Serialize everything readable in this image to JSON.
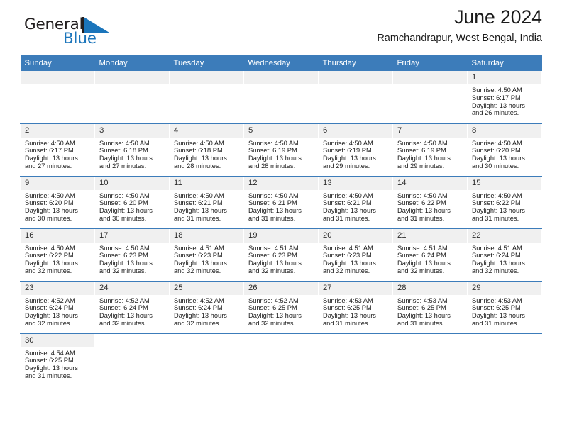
{
  "brand": {
    "name_top": "General",
    "name_bottom": "Blue",
    "accent_color": "#1b75bb"
  },
  "header": {
    "title": "June 2024",
    "subtitle": "Ramchandrapur, West Bengal, India"
  },
  "theme": {
    "header_bg": "#3c7cba",
    "daynum_bg": "#f0f0f0",
    "grid_line": "#3c7cba",
    "text": "#1a1a1a"
  },
  "weekday_headers": [
    "Sunday",
    "Monday",
    "Tuesday",
    "Wednesday",
    "Thursday",
    "Friday",
    "Saturday"
  ],
  "labels": {
    "sunrise": "Sunrise:",
    "sunset": "Sunset:",
    "daylight": "Daylight:"
  },
  "weeks": [
    [
      {
        "empty": true
      },
      {
        "empty": true
      },
      {
        "empty": true
      },
      {
        "empty": true
      },
      {
        "empty": true
      },
      {
        "empty": true
      },
      {
        "day": "1",
        "sunrise": "Sunrise: 4:50 AM",
        "sunset": "Sunset: 6:17 PM",
        "daylight1": "Daylight: 13 hours",
        "daylight2": "and 26 minutes."
      }
    ],
    [
      {
        "day": "2",
        "sunrise": "Sunrise: 4:50 AM",
        "sunset": "Sunset: 6:17 PM",
        "daylight1": "Daylight: 13 hours",
        "daylight2": "and 27 minutes."
      },
      {
        "day": "3",
        "sunrise": "Sunrise: 4:50 AM",
        "sunset": "Sunset: 6:18 PM",
        "daylight1": "Daylight: 13 hours",
        "daylight2": "and 27 minutes."
      },
      {
        "day": "4",
        "sunrise": "Sunrise: 4:50 AM",
        "sunset": "Sunset: 6:18 PM",
        "daylight1": "Daylight: 13 hours",
        "daylight2": "and 28 minutes."
      },
      {
        "day": "5",
        "sunrise": "Sunrise: 4:50 AM",
        "sunset": "Sunset: 6:19 PM",
        "daylight1": "Daylight: 13 hours",
        "daylight2": "and 28 minutes."
      },
      {
        "day": "6",
        "sunrise": "Sunrise: 4:50 AM",
        "sunset": "Sunset: 6:19 PM",
        "daylight1": "Daylight: 13 hours",
        "daylight2": "and 29 minutes."
      },
      {
        "day": "7",
        "sunrise": "Sunrise: 4:50 AM",
        "sunset": "Sunset: 6:19 PM",
        "daylight1": "Daylight: 13 hours",
        "daylight2": "and 29 minutes."
      },
      {
        "day": "8",
        "sunrise": "Sunrise: 4:50 AM",
        "sunset": "Sunset: 6:20 PM",
        "daylight1": "Daylight: 13 hours",
        "daylight2": "and 30 minutes."
      }
    ],
    [
      {
        "day": "9",
        "sunrise": "Sunrise: 4:50 AM",
        "sunset": "Sunset: 6:20 PM",
        "daylight1": "Daylight: 13 hours",
        "daylight2": "and 30 minutes."
      },
      {
        "day": "10",
        "sunrise": "Sunrise: 4:50 AM",
        "sunset": "Sunset: 6:20 PM",
        "daylight1": "Daylight: 13 hours",
        "daylight2": "and 30 minutes."
      },
      {
        "day": "11",
        "sunrise": "Sunrise: 4:50 AM",
        "sunset": "Sunset: 6:21 PM",
        "daylight1": "Daylight: 13 hours",
        "daylight2": "and 31 minutes."
      },
      {
        "day": "12",
        "sunrise": "Sunrise: 4:50 AM",
        "sunset": "Sunset: 6:21 PM",
        "daylight1": "Daylight: 13 hours",
        "daylight2": "and 31 minutes."
      },
      {
        "day": "13",
        "sunrise": "Sunrise: 4:50 AM",
        "sunset": "Sunset: 6:21 PM",
        "daylight1": "Daylight: 13 hours",
        "daylight2": "and 31 minutes."
      },
      {
        "day": "14",
        "sunrise": "Sunrise: 4:50 AM",
        "sunset": "Sunset: 6:22 PM",
        "daylight1": "Daylight: 13 hours",
        "daylight2": "and 31 minutes."
      },
      {
        "day": "15",
        "sunrise": "Sunrise: 4:50 AM",
        "sunset": "Sunset: 6:22 PM",
        "daylight1": "Daylight: 13 hours",
        "daylight2": "and 31 minutes."
      }
    ],
    [
      {
        "day": "16",
        "sunrise": "Sunrise: 4:50 AM",
        "sunset": "Sunset: 6:22 PM",
        "daylight1": "Daylight: 13 hours",
        "daylight2": "and 32 minutes."
      },
      {
        "day": "17",
        "sunrise": "Sunrise: 4:50 AM",
        "sunset": "Sunset: 6:23 PM",
        "daylight1": "Daylight: 13 hours",
        "daylight2": "and 32 minutes."
      },
      {
        "day": "18",
        "sunrise": "Sunrise: 4:51 AM",
        "sunset": "Sunset: 6:23 PM",
        "daylight1": "Daylight: 13 hours",
        "daylight2": "and 32 minutes."
      },
      {
        "day": "19",
        "sunrise": "Sunrise: 4:51 AM",
        "sunset": "Sunset: 6:23 PM",
        "daylight1": "Daylight: 13 hours",
        "daylight2": "and 32 minutes."
      },
      {
        "day": "20",
        "sunrise": "Sunrise: 4:51 AM",
        "sunset": "Sunset: 6:23 PM",
        "daylight1": "Daylight: 13 hours",
        "daylight2": "and 32 minutes."
      },
      {
        "day": "21",
        "sunrise": "Sunrise: 4:51 AM",
        "sunset": "Sunset: 6:24 PM",
        "daylight1": "Daylight: 13 hours",
        "daylight2": "and 32 minutes."
      },
      {
        "day": "22",
        "sunrise": "Sunrise: 4:51 AM",
        "sunset": "Sunset: 6:24 PM",
        "daylight1": "Daylight: 13 hours",
        "daylight2": "and 32 minutes."
      }
    ],
    [
      {
        "day": "23",
        "sunrise": "Sunrise: 4:52 AM",
        "sunset": "Sunset: 6:24 PM",
        "daylight1": "Daylight: 13 hours",
        "daylight2": "and 32 minutes."
      },
      {
        "day": "24",
        "sunrise": "Sunrise: 4:52 AM",
        "sunset": "Sunset: 6:24 PM",
        "daylight1": "Daylight: 13 hours",
        "daylight2": "and 32 minutes."
      },
      {
        "day": "25",
        "sunrise": "Sunrise: 4:52 AM",
        "sunset": "Sunset: 6:24 PM",
        "daylight1": "Daylight: 13 hours",
        "daylight2": "and 32 minutes."
      },
      {
        "day": "26",
        "sunrise": "Sunrise: 4:52 AM",
        "sunset": "Sunset: 6:25 PM",
        "daylight1": "Daylight: 13 hours",
        "daylight2": "and 32 minutes."
      },
      {
        "day": "27",
        "sunrise": "Sunrise: 4:53 AM",
        "sunset": "Sunset: 6:25 PM",
        "daylight1": "Daylight: 13 hours",
        "daylight2": "and 31 minutes."
      },
      {
        "day": "28",
        "sunrise": "Sunrise: 4:53 AM",
        "sunset": "Sunset: 6:25 PM",
        "daylight1": "Daylight: 13 hours",
        "daylight2": "and 31 minutes."
      },
      {
        "day": "29",
        "sunrise": "Sunrise: 4:53 AM",
        "sunset": "Sunset: 6:25 PM",
        "daylight1": "Daylight: 13 hours",
        "daylight2": "and 31 minutes."
      }
    ],
    [
      {
        "day": "30",
        "sunrise": "Sunrise: 4:54 AM",
        "sunset": "Sunset: 6:25 PM",
        "daylight1": "Daylight: 13 hours",
        "daylight2": "and 31 minutes."
      },
      {
        "blank": true
      },
      {
        "blank": true
      },
      {
        "blank": true
      },
      {
        "blank": true
      },
      {
        "blank": true
      },
      {
        "blank": true
      }
    ]
  ]
}
